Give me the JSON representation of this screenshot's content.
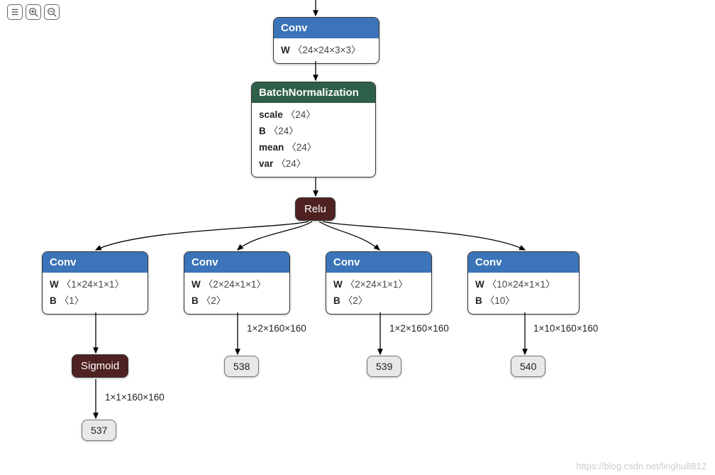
{
  "toolbar": {
    "listBtn": "≡",
    "zoomInBtn": "+",
    "zoomOutBtn": "−"
  },
  "conv1": {
    "title": "Conv",
    "w_label": "W",
    "w_val": "〈24×24×3×3〉"
  },
  "bn": {
    "title": "BatchNormalization",
    "scale_label": "scale",
    "scale_val": "〈24〉",
    "b_label": "B",
    "b_val": "〈24〉",
    "mean_label": "mean",
    "mean_val": "〈24〉",
    "var_label": "var",
    "var_val": "〈24〉"
  },
  "relu": {
    "label": "Relu"
  },
  "branches": [
    {
      "title": "Conv",
      "w_label": "W",
      "w_val": "〈1×24×1×1〉",
      "b_label": "B",
      "b_val": "〈1〉"
    },
    {
      "title": "Conv",
      "w_label": "W",
      "w_val": "〈2×24×1×1〉",
      "b_label": "B",
      "b_val": "〈2〉"
    },
    {
      "title": "Conv",
      "w_label": "W",
      "w_val": "〈2×24×1×1〉",
      "b_label": "B",
      "b_val": "〈2〉"
    },
    {
      "title": "Conv",
      "w_label": "W",
      "w_val": "〈10×24×1×1〉",
      "b_label": "B",
      "b_val": "〈10〉"
    }
  ],
  "sigmoid": {
    "label": "Sigmoid"
  },
  "edgeLabels": {
    "b2": "1×2×160×160",
    "b3": "1×2×160×160",
    "b4": "1×10×160×160",
    "sig": "1×1×160×160"
  },
  "terms": {
    "t537": "537",
    "t538": "538",
    "t539": "539",
    "t540": "540"
  },
  "watermark": "https://blog.csdn.net/linghu8812"
}
